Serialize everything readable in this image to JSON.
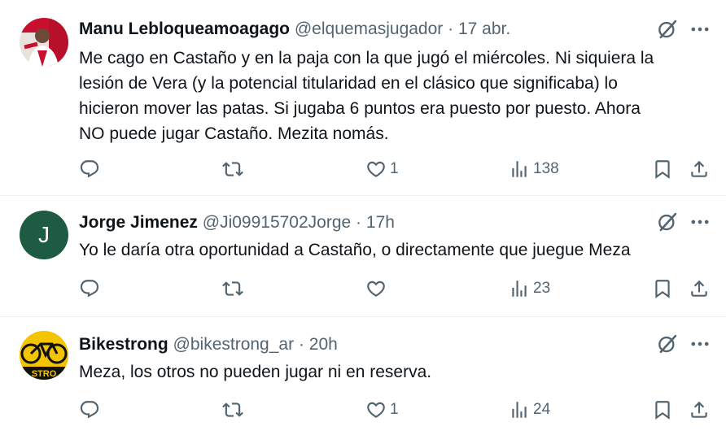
{
  "tweets": [
    {
      "name": "Manu Lebloqueamoagago",
      "handle": "@elquemasjugador",
      "separator": "·",
      "time": "17 abr.",
      "avatar": {
        "type": "photo",
        "colors": [
          "#c8102e",
          "#f4f1ee",
          "#2b2b2b"
        ]
      },
      "text_lines": [
        "Me cago en Castaño y en la paja con la que jugó el miércoles. Ni siquiera la",
        "lesión de Vera (y la potencial titularidad en el clásico que significaba) lo",
        "hicieron mover las patas. Si jugaba 6 puntos era puesto por puesto. Ahora",
        "NO puede jugar Castaño. Mezita nomás."
      ],
      "reply_count": "",
      "retweet_count": "",
      "like_count": "1",
      "views_count": "138"
    },
    {
      "name": "Jorge Jimenez",
      "handle": "@Ji09915702Jorge",
      "separator": "·",
      "time": "17h",
      "avatar": {
        "type": "letter",
        "letter": "J",
        "bg": "#1d5c42"
      },
      "text_lines": [
        "Yo le daría otra oportunidad a Castaño, o directamente que juegue Meza"
      ],
      "reply_count": "",
      "retweet_count": "",
      "like_count": "",
      "views_count": "23"
    },
    {
      "name": "Bikestrong",
      "handle": "@bikestrong_ar",
      "separator": "·",
      "time": "20h",
      "avatar": {
        "type": "logo",
        "bg": "#f5c400",
        "logo_text": "STRO"
      },
      "text_lines": [
        "Meza, los otros no pueden jugar ni en reserva."
      ],
      "reply_count": "",
      "retweet_count": "",
      "like_count": "1",
      "views_count": "24"
    }
  ],
  "icons": {
    "grok": "grok-icon",
    "more": "more-icon",
    "reply": "reply-icon",
    "retweet": "retweet-icon",
    "like": "like-icon",
    "views": "views-icon",
    "bookmark": "bookmark-icon",
    "share": "share-icon"
  },
  "colors": {
    "text": "#0f1419",
    "secondary": "#536471",
    "divider": "#eff3f4"
  }
}
